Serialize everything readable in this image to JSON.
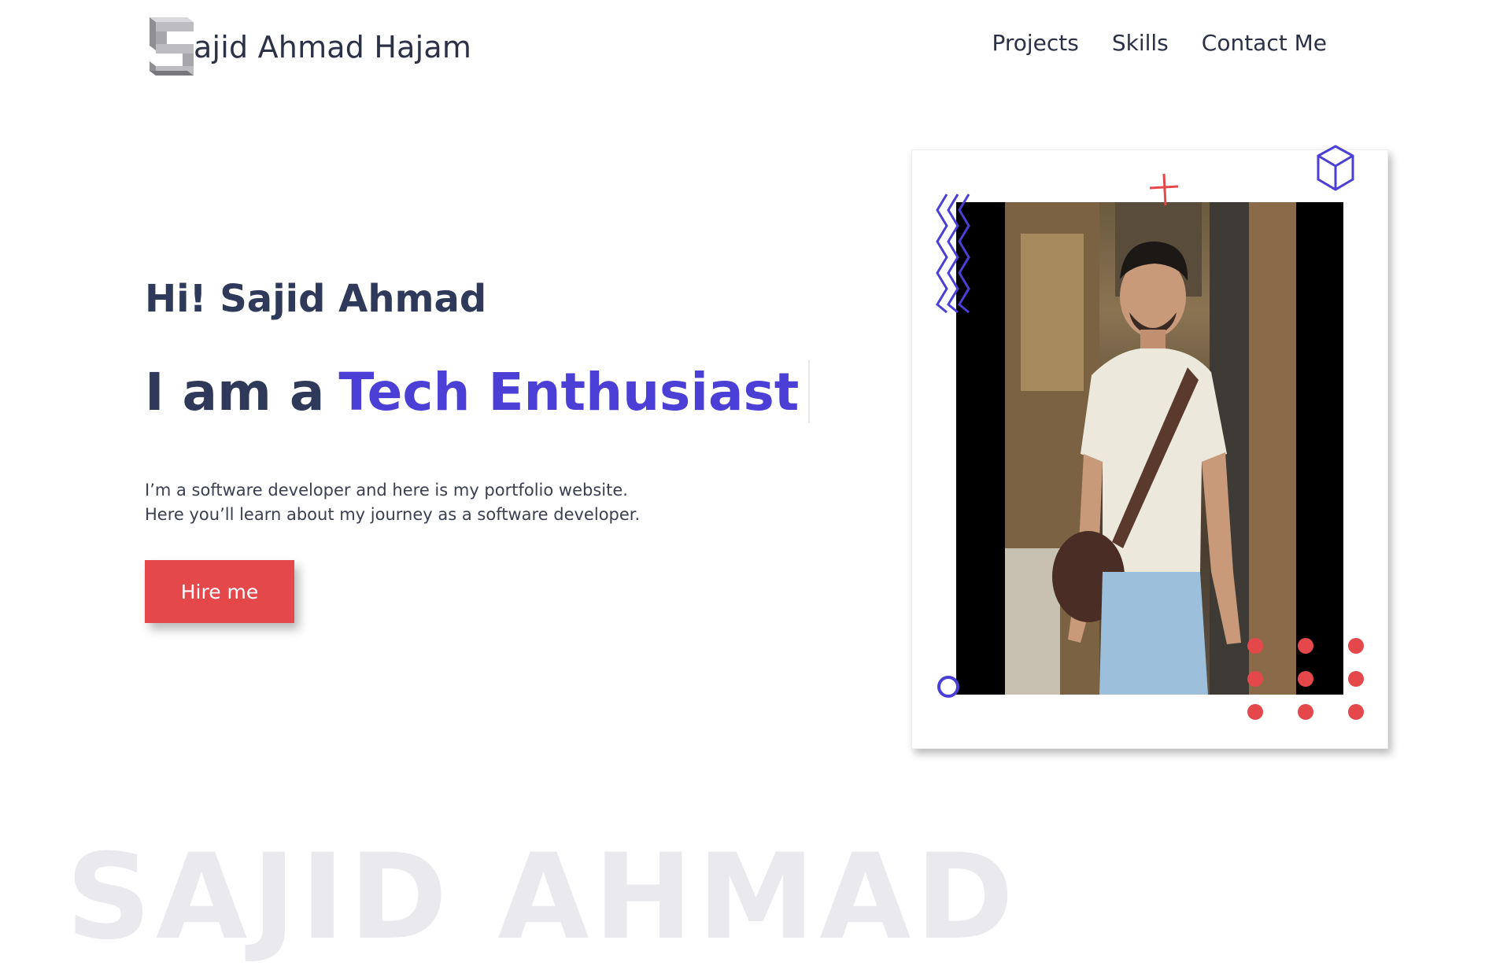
{
  "header": {
    "logo_letter": "S",
    "logo_text": "ajid Ahmad Hajam",
    "nav": [
      {
        "label": "Projects"
      },
      {
        "label": "Skills"
      },
      {
        "label": "Contact Me"
      }
    ]
  },
  "hero": {
    "greeting": "Hi! Sajid Ahmad",
    "headline_prefix": "I am a",
    "headline_accent": "Tech Enthusiast",
    "description_line1": "I’m a software developer and here is my portfolio website.",
    "description_line2": "Here you’ll learn about my journey as a software developer.",
    "cta_label": "Hire me"
  },
  "watermark": "SAJID AHMAD",
  "colors": {
    "accent": "#4b3fd6",
    "cta": "#e5484a",
    "text": "#2b3147"
  },
  "icons": {
    "zigzag": "zigzag-decoration-icon",
    "plus": "plus-decoration-icon",
    "cube": "cube-decoration-icon",
    "ring": "ring-decoration-icon",
    "dots": "dot-grid-decoration-icon"
  }
}
